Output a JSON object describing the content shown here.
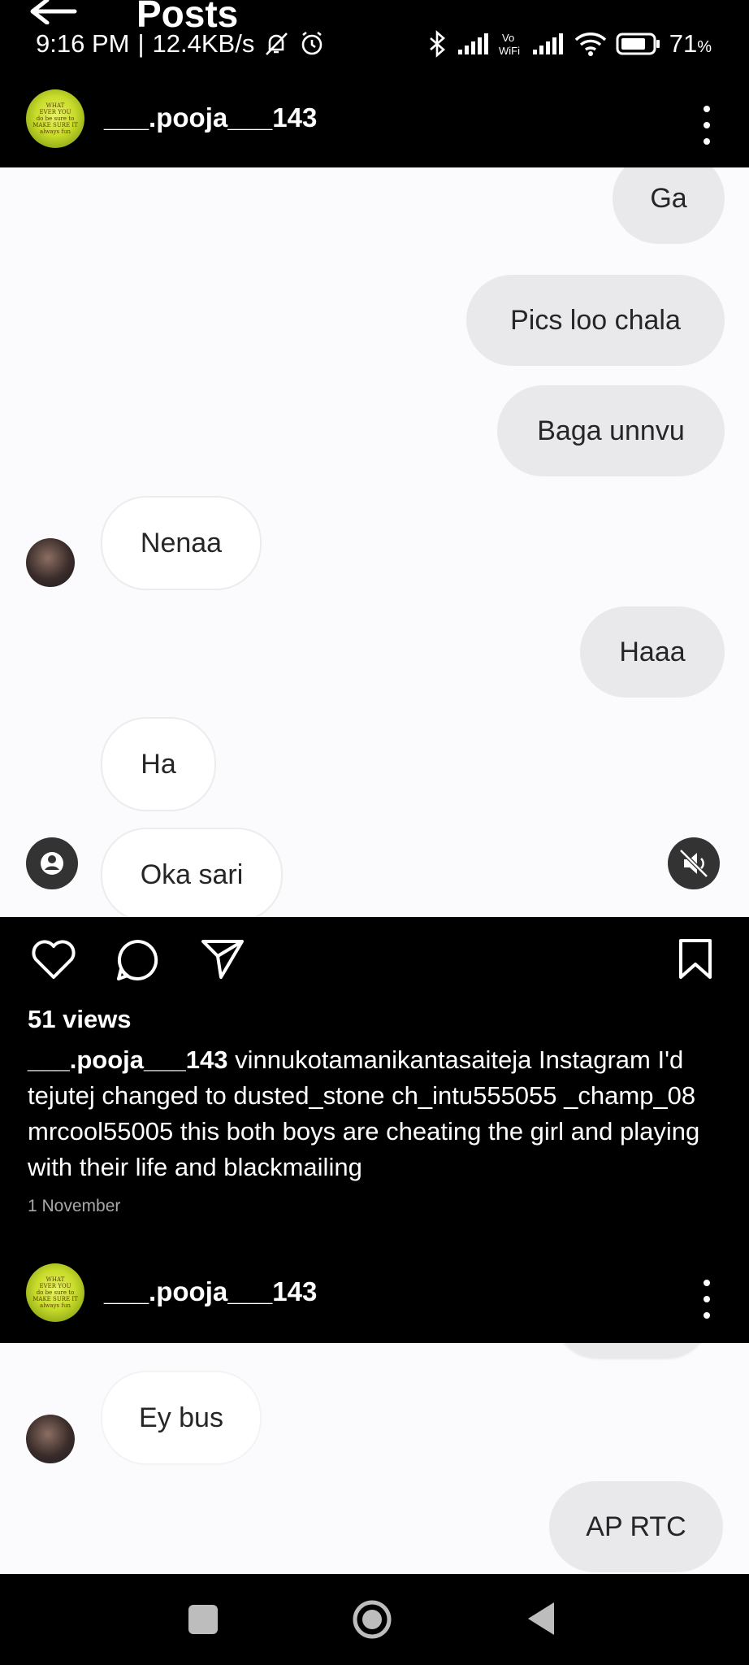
{
  "status_bar": {
    "page_title": "Posts",
    "time": "9:16 PM",
    "speed": "12.4KB/s",
    "battery": "71",
    "battery_unit": "%"
  },
  "post1": {
    "username": "___.pooja___143",
    "logo_text": [
      "WHAT",
      "EVER YOU",
      "do be sure to",
      "MAKE SURE IT",
      "always fun"
    ],
    "chat": [
      {
        "text": "Ga",
        "side": "out"
      },
      {
        "text": "Pics loo chala",
        "side": "out"
      },
      {
        "text": "Baga unnvu",
        "side": "out"
      },
      {
        "text": "Nenaa",
        "side": "in"
      },
      {
        "text": "Haaa",
        "side": "out"
      },
      {
        "text": "Ha",
        "side": "in"
      },
      {
        "text": "Oka sari",
        "side": "in"
      }
    ],
    "views": "51 views",
    "caption_user": "___.pooja___143",
    "caption_text": " vinnukotamanikantasaiteja Instagram I'd tejutej changed to dusted_stone ch_intu555055 _champ_08 mrcool55005 this both boys are cheating the girl and playing with their life and blackmailing",
    "date": "1 November"
  },
  "post2": {
    "username": "___.pooja___143",
    "chat": [
      {
        "text": "Ey bus",
        "side": "in"
      },
      {
        "text": "AP RTC",
        "side": "out"
      }
    ]
  },
  "icons": {
    "like": "heart-icon",
    "comment": "comment-icon",
    "share": "send-icon",
    "save": "bookmark-icon"
  }
}
